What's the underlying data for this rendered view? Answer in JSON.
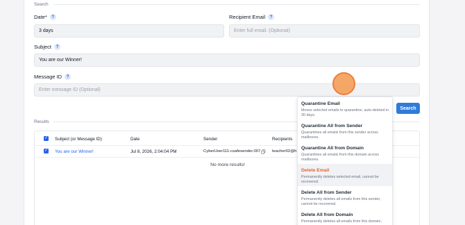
{
  "search_section": {
    "title": "Search",
    "date_label": "Date*",
    "date_value": "3 days",
    "recipient_label": "Recipient Email",
    "recipient_placeholder": "Enter full email. (Optional)",
    "subject_label": "Subject",
    "subject_value": "You are our Winner!",
    "message_id_label": "Message ID",
    "message_id_placeholder": "Enter message ID (Optional)",
    "help_glyph": "?",
    "search_button": "Search"
  },
  "results": {
    "title": "Results",
    "columns": [
      "Subject (or Message ID)",
      "Date",
      "Sender",
      "Recipients"
    ],
    "rows": [
      {
        "subject": "You are our Winner!",
        "date": "Jul 8, 2026, 2:04:04 PM",
        "sender": "CyberUser111-csafesender.007",
        "recipients": "teacher02@h"
      }
    ],
    "empty_message": "No more results!"
  },
  "action_menu": {
    "items": [
      {
        "title": "Quarantine Email",
        "desc": "Moves selected emails to quarantine, auto-deleted in 30 days."
      },
      {
        "title": "Quarantine All from Sender",
        "desc": "Quarantines all emails from this sender across mailboxes."
      },
      {
        "title": "Quarantine All from Domain",
        "desc": "Quarantines all emails from this domain across mailboxes."
      },
      {
        "title": "Delete Email",
        "desc": "Permanently deletes selected email, cannot be recovered."
      },
      {
        "title": "Delete All from Sender",
        "desc": "Permanently deletes all emails from this sender, cannot be recovered."
      },
      {
        "title": "Delete All from Domain",
        "desc": "Permanently deletes all emails from this domain,"
      }
    ]
  },
  "colors": {
    "accent": "#2f7bd9",
    "danger": "#e8612c",
    "cursor": "#f5a05c"
  }
}
